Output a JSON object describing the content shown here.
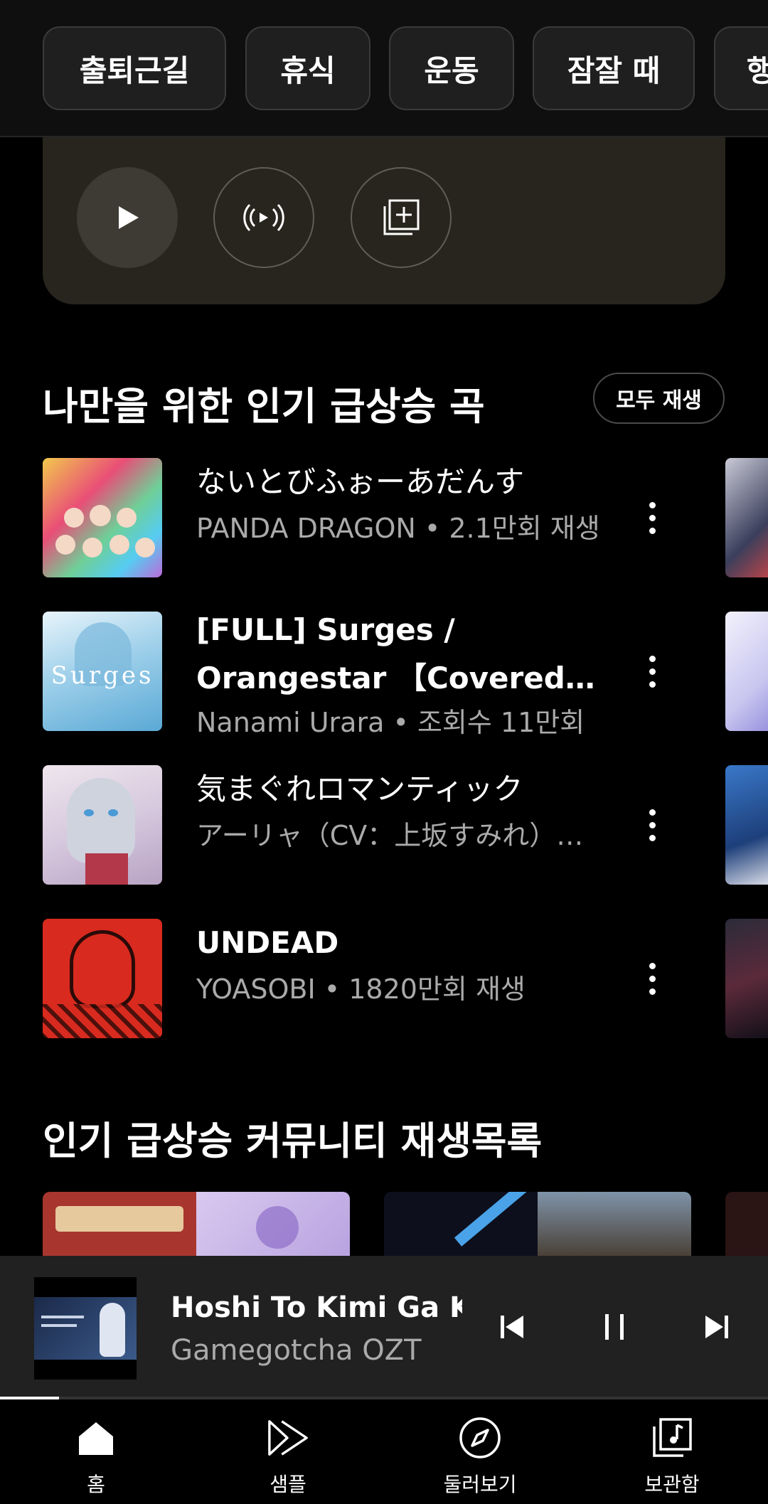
{
  "chips": [
    "출퇴근길",
    "휴식",
    "운동",
    "잠잘 때",
    "행"
  ],
  "trending": {
    "title": "나만을 위한 인기 급상승 곡",
    "play_all_label": "모두 재생",
    "songs": [
      {
        "title": "ないとびふぉーあだんす",
        "subtitle": "PANDA DRAGON • 2.1만회 재생"
      },
      {
        "title": "[FULL] Surges / Orangestar 【Covered by…",
        "subtitle": "Nanami Urara • 조회수 11만회"
      },
      {
        "title": "気まぐれロマンティック",
        "subtitle": "アーリャ（CV：上坂すみれ）…"
      },
      {
        "title": "UNDEAD",
        "subtitle": "YOASOBI • 1820만회 재생"
      }
    ]
  },
  "community": {
    "title": "인기 급상승 커뮤니티 재생목록"
  },
  "player": {
    "title": "Hoshi To Kimi Ga Kieta",
    "artist": "Gamegotcha OZT",
    "progress": 0.077
  },
  "nav": [
    {
      "label": "홈",
      "icon": "home-icon",
      "active": true
    },
    {
      "label": "샘플",
      "icon": "samples-icon"
    },
    {
      "label": "둘러보기",
      "icon": "explore-icon"
    },
    {
      "label": "보관함",
      "icon": "library-icon"
    }
  ],
  "colors": {
    "background": "#000000",
    "chip_bg": "#1f1f1f",
    "card_bg": "#27251d",
    "mini_player_bg": "#212121",
    "secondary_text": "#aaaaaa"
  }
}
